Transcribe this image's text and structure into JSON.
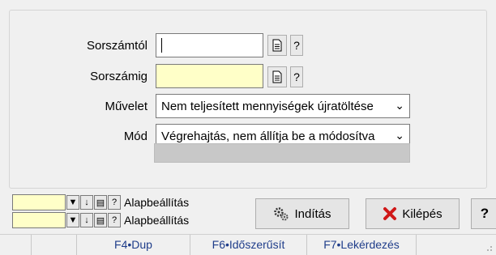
{
  "form": {
    "from_label": "Sorszámtól",
    "from_value": "",
    "to_label": "Sorszámig",
    "to_value": "",
    "help_label": "?",
    "operation_label": "Művelet",
    "operation_value": "Nem teljesített mennyiségek újratöltése",
    "mode_label": "Mód",
    "mode_value": "Végrehajtás, nem állítja be a módosítva",
    "progress": 0
  },
  "presets": [
    {
      "value": "",
      "label": "Alapbeállítás"
    },
    {
      "value": "",
      "label": "Alapbeállítás"
    }
  ],
  "preset_help": "?",
  "buttons": {
    "start": "Indítás",
    "exit": "Kilépés",
    "help": "?"
  },
  "statusbar": {
    "items": [
      "F4•Dup",
      "F6•Időszerűsít",
      "F7•Lekérdezés"
    ]
  },
  "icons": {
    "browse": "document-icon",
    "chevron": "chevron-down-icon",
    "start": "gears-icon",
    "exit": "red-x-icon",
    "down_arrow": "arrow-down-icon",
    "dropdown": "dropdown-arrow-icon"
  }
}
